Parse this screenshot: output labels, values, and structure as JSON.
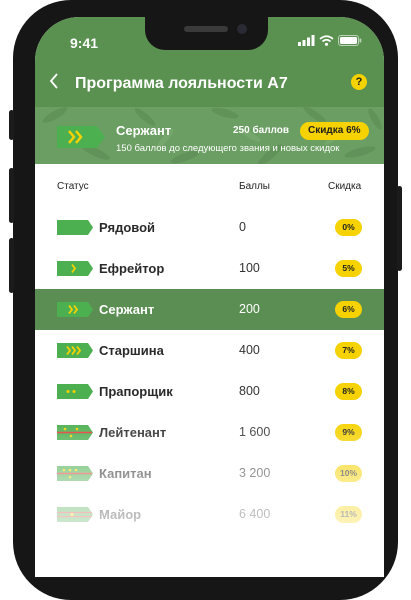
{
  "status_bar": {
    "time": "9:41"
  },
  "header": {
    "title": "Программа лояльности А7",
    "help_label": "?"
  },
  "banner": {
    "rank": "Сержант",
    "points": "250 баллов",
    "discount": "Скидка 6%",
    "next_rank_text": "150 баллов до следующего звания и новых скидок"
  },
  "table": {
    "headers": {
      "status": "Статус",
      "points": "Баллы",
      "discount": "Скидка"
    },
    "rows": [
      {
        "name": "Рядовой",
        "points": "0",
        "discount": "0%",
        "badge": "plain",
        "active": false
      },
      {
        "name": "Ефрейтор",
        "points": "100",
        "discount": "5%",
        "badge": "chevron-1",
        "active": false
      },
      {
        "name": "Сержант",
        "points": "200",
        "discount": "6%",
        "badge": "chevron-2",
        "active": true
      },
      {
        "name": "Старшина",
        "points": "400",
        "discount": "7%",
        "badge": "chevron-3",
        "active": false
      },
      {
        "name": "Прапорщик",
        "points": "800",
        "discount": "8%",
        "badge": "star-2",
        "active": false
      },
      {
        "name": "Лейтенант",
        "points": "1 600",
        "discount": "9%",
        "badge": "star-3-stripe",
        "active": false
      },
      {
        "name": "Капитан",
        "points": "3 200",
        "discount": "10%",
        "badge": "star-4-stripe",
        "active": false
      },
      {
        "name": "Майор",
        "points": "6 400",
        "discount": "11%",
        "badge": "star-1-stripe",
        "active": false
      }
    ]
  },
  "colors": {
    "primary_green": "#5a9150",
    "badge_green": "#4caf50",
    "accent_yellow": "#f5d200"
  }
}
